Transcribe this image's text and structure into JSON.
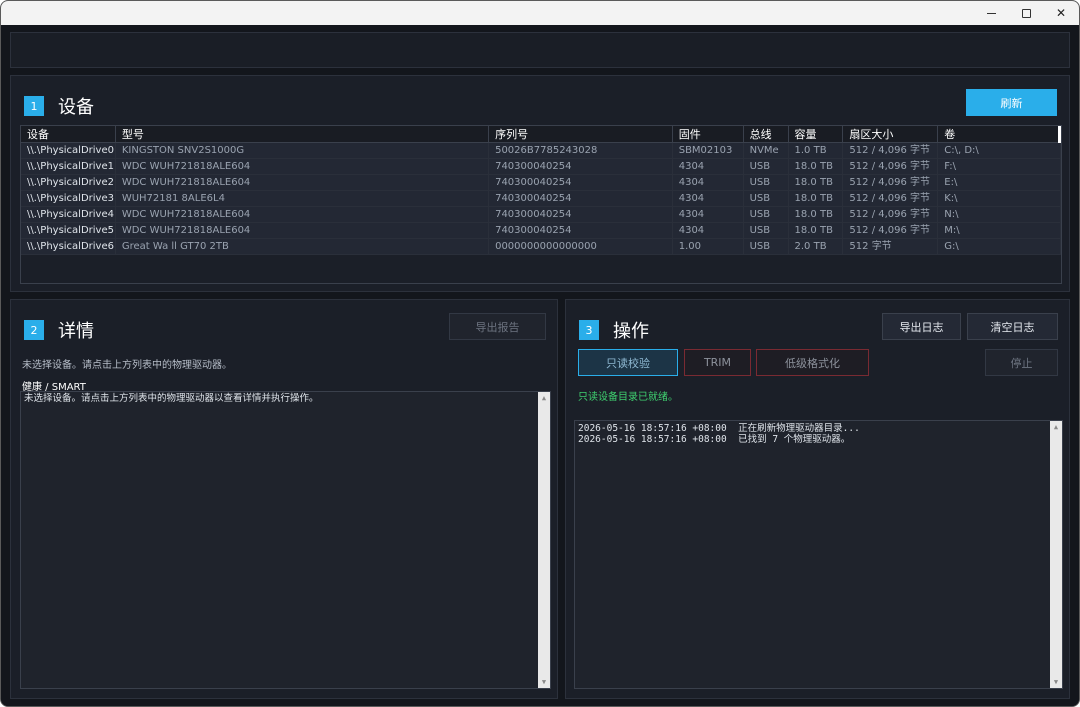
{
  "window": {
    "minimize_icon": "minimize-icon",
    "maximize_icon": "maximize-icon",
    "close_label": "✕"
  },
  "devices": {
    "number": "1",
    "title": "设备",
    "refresh_label": "刷新",
    "columns": [
      "设备",
      "型号",
      "序列号",
      "固件",
      "总线",
      "容量",
      "扇区大小",
      "卷"
    ],
    "rows": [
      [
        "\\\\.\\PhysicalDrive0",
        "KINGSTON SNV2S1000G",
        "50026B7785243028",
        "SBM02103",
        "NVMe",
        "1.0 TB",
        "512 / 4,096 字节",
        "C:\\, D:\\"
      ],
      [
        "\\\\.\\PhysicalDrive1",
        "WDC WUH721818ALE604",
        "740300040254",
        "4304",
        "USB",
        "18.0 TB",
        "512 / 4,096 字节",
        "F:\\"
      ],
      [
        "\\\\.\\PhysicalDrive2",
        "WDC WUH721818ALE604",
        "740300040254",
        "4304",
        "USB",
        "18.0 TB",
        "512 / 4,096 字节",
        "E:\\"
      ],
      [
        "\\\\.\\PhysicalDrive3",
        "WUH72181 8ALE6L4",
        "740300040254",
        "4304",
        "USB",
        "18.0 TB",
        "512 / 4,096 字节",
        "K:\\"
      ],
      [
        "\\\\.\\PhysicalDrive4",
        "WDC WUH721818ALE604",
        "740300040254",
        "4304",
        "USB",
        "18.0 TB",
        "512 / 4,096 字节",
        "N:\\"
      ],
      [
        "\\\\.\\PhysicalDrive5",
        "WDC WUH721818ALE604",
        "740300040254",
        "4304",
        "USB",
        "18.0 TB",
        "512 / 4,096 字节",
        "M:\\"
      ],
      [
        "\\\\.\\PhysicalDrive6",
        "Great Wa ll GT70 2TB",
        "0000000000000000",
        "1.00",
        "USB",
        "2.0 TB",
        "512 字节",
        "G:\\"
      ]
    ]
  },
  "details": {
    "number": "2",
    "title": "详情",
    "export_label": "导出报告",
    "hint": "未选择设备。请点击上方列表中的物理驱动器。",
    "smart_label": "健康 / SMART",
    "smart_text": "未选择设备。请点击上方列表中的物理驱动器以查看详情并执行操作。"
  },
  "ops": {
    "number": "3",
    "title": "操作",
    "export_log_label": "导出日志",
    "clear_log_label": "清空日志",
    "verify_label": "只读校验",
    "trim_label": "TRIM",
    "format_label": "低级格式化",
    "stop_label": "停止",
    "status": "只读设备目录已就绪。",
    "log": [
      "2026-05-16 18:57:16 +08:00  正在刷新物理驱动器目录...",
      "2026-05-16 18:57:16 +08:00  已找到 7 个物理驱动器。"
    ]
  },
  "colors": {
    "accent": "#2aaeea",
    "ok": "#3fd06f",
    "danger_border": "#7a2a32",
    "background": "#13161c"
  }
}
